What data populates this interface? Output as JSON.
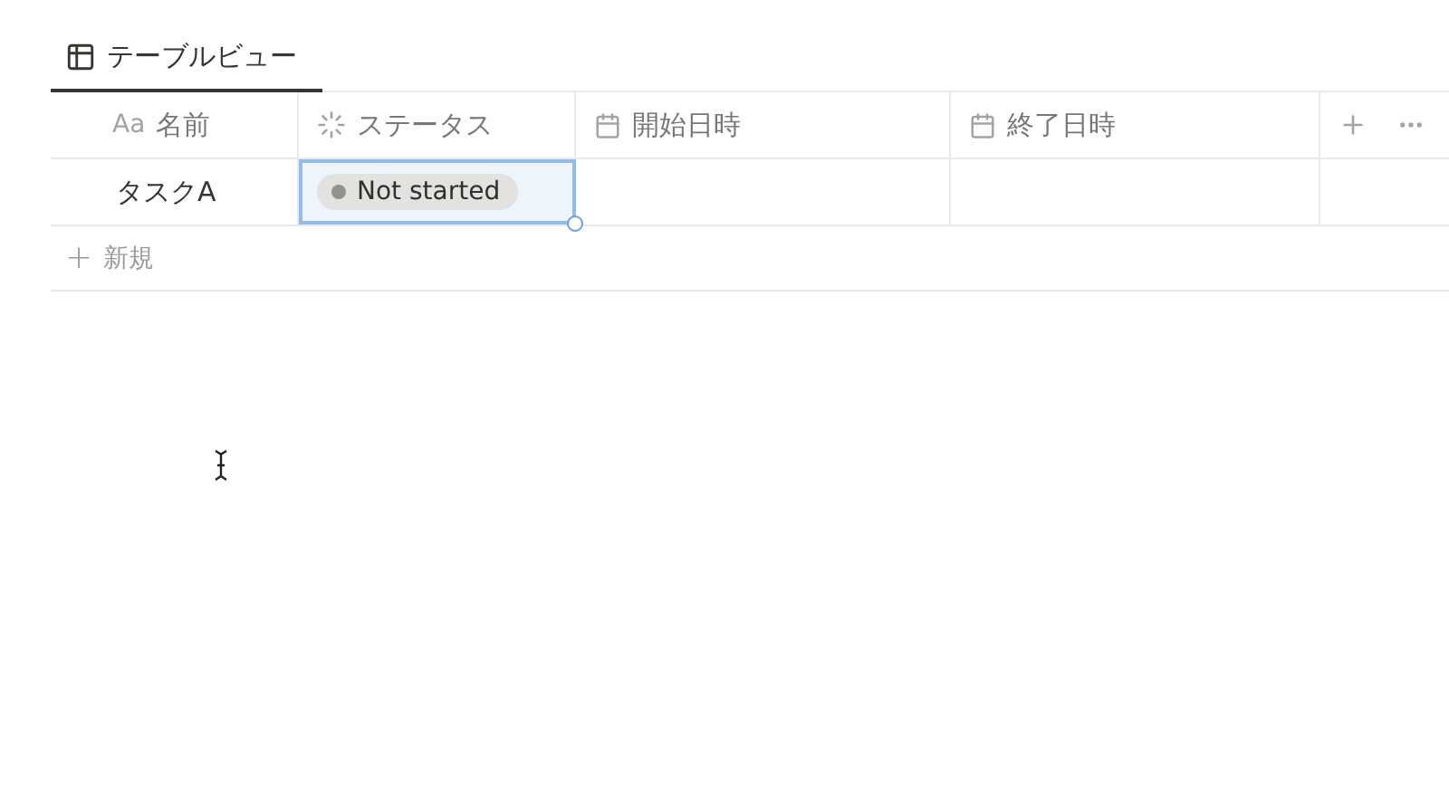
{
  "tabs": [
    {
      "label": "テーブルビュー",
      "selected": true
    }
  ],
  "table": {
    "columns": [
      {
        "kind": "title",
        "prefix": "Aa",
        "label": "名前"
      },
      {
        "kind": "status",
        "label": "ステータス"
      },
      {
        "kind": "date",
        "label": "開始日時"
      },
      {
        "kind": "date",
        "label": "終了日時"
      }
    ],
    "rows": [
      {
        "name": "タスクA",
        "status": {
          "label": "Not started",
          "color": "#91918e",
          "selected": true
        },
        "start": "",
        "end": ""
      }
    ],
    "new_row": {
      "icon": "+",
      "label": "新規"
    }
  }
}
